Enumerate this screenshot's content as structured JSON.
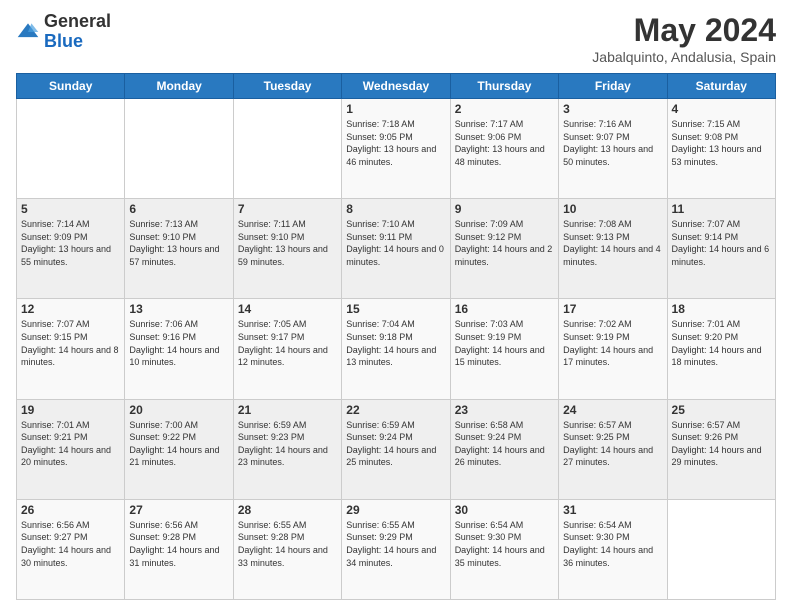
{
  "header": {
    "logo_general": "General",
    "logo_blue": "Blue",
    "month_title": "May 2024",
    "location": "Jabalquinto, Andalusia, Spain"
  },
  "days_of_week": [
    "Sunday",
    "Monday",
    "Tuesday",
    "Wednesday",
    "Thursday",
    "Friday",
    "Saturday"
  ],
  "weeks": [
    [
      {
        "day": "",
        "info": ""
      },
      {
        "day": "",
        "info": ""
      },
      {
        "day": "",
        "info": ""
      },
      {
        "day": "1",
        "info": "Sunrise: 7:18 AM\nSunset: 9:05 PM\nDaylight: 13 hours and 46 minutes."
      },
      {
        "day": "2",
        "info": "Sunrise: 7:17 AM\nSunset: 9:06 PM\nDaylight: 13 hours and 48 minutes."
      },
      {
        "day": "3",
        "info": "Sunrise: 7:16 AM\nSunset: 9:07 PM\nDaylight: 13 hours and 50 minutes."
      },
      {
        "day": "4",
        "info": "Sunrise: 7:15 AM\nSunset: 9:08 PM\nDaylight: 13 hours and 53 minutes."
      }
    ],
    [
      {
        "day": "5",
        "info": "Sunrise: 7:14 AM\nSunset: 9:09 PM\nDaylight: 13 hours and 55 minutes."
      },
      {
        "day": "6",
        "info": "Sunrise: 7:13 AM\nSunset: 9:10 PM\nDaylight: 13 hours and 57 minutes."
      },
      {
        "day": "7",
        "info": "Sunrise: 7:11 AM\nSunset: 9:10 PM\nDaylight: 13 hours and 59 minutes."
      },
      {
        "day": "8",
        "info": "Sunrise: 7:10 AM\nSunset: 9:11 PM\nDaylight: 14 hours and 0 minutes."
      },
      {
        "day": "9",
        "info": "Sunrise: 7:09 AM\nSunset: 9:12 PM\nDaylight: 14 hours and 2 minutes."
      },
      {
        "day": "10",
        "info": "Sunrise: 7:08 AM\nSunset: 9:13 PM\nDaylight: 14 hours and 4 minutes."
      },
      {
        "day": "11",
        "info": "Sunrise: 7:07 AM\nSunset: 9:14 PM\nDaylight: 14 hours and 6 minutes."
      }
    ],
    [
      {
        "day": "12",
        "info": "Sunrise: 7:07 AM\nSunset: 9:15 PM\nDaylight: 14 hours and 8 minutes."
      },
      {
        "day": "13",
        "info": "Sunrise: 7:06 AM\nSunset: 9:16 PM\nDaylight: 14 hours and 10 minutes."
      },
      {
        "day": "14",
        "info": "Sunrise: 7:05 AM\nSunset: 9:17 PM\nDaylight: 14 hours and 12 minutes."
      },
      {
        "day": "15",
        "info": "Sunrise: 7:04 AM\nSunset: 9:18 PM\nDaylight: 14 hours and 13 minutes."
      },
      {
        "day": "16",
        "info": "Sunrise: 7:03 AM\nSunset: 9:19 PM\nDaylight: 14 hours and 15 minutes."
      },
      {
        "day": "17",
        "info": "Sunrise: 7:02 AM\nSunset: 9:19 PM\nDaylight: 14 hours and 17 minutes."
      },
      {
        "day": "18",
        "info": "Sunrise: 7:01 AM\nSunset: 9:20 PM\nDaylight: 14 hours and 18 minutes."
      }
    ],
    [
      {
        "day": "19",
        "info": "Sunrise: 7:01 AM\nSunset: 9:21 PM\nDaylight: 14 hours and 20 minutes."
      },
      {
        "day": "20",
        "info": "Sunrise: 7:00 AM\nSunset: 9:22 PM\nDaylight: 14 hours and 21 minutes."
      },
      {
        "day": "21",
        "info": "Sunrise: 6:59 AM\nSunset: 9:23 PM\nDaylight: 14 hours and 23 minutes."
      },
      {
        "day": "22",
        "info": "Sunrise: 6:59 AM\nSunset: 9:24 PM\nDaylight: 14 hours and 25 minutes."
      },
      {
        "day": "23",
        "info": "Sunrise: 6:58 AM\nSunset: 9:24 PM\nDaylight: 14 hours and 26 minutes."
      },
      {
        "day": "24",
        "info": "Sunrise: 6:57 AM\nSunset: 9:25 PM\nDaylight: 14 hours and 27 minutes."
      },
      {
        "day": "25",
        "info": "Sunrise: 6:57 AM\nSunset: 9:26 PM\nDaylight: 14 hours and 29 minutes."
      }
    ],
    [
      {
        "day": "26",
        "info": "Sunrise: 6:56 AM\nSunset: 9:27 PM\nDaylight: 14 hours and 30 minutes."
      },
      {
        "day": "27",
        "info": "Sunrise: 6:56 AM\nSunset: 9:28 PM\nDaylight: 14 hours and 31 minutes."
      },
      {
        "day": "28",
        "info": "Sunrise: 6:55 AM\nSunset: 9:28 PM\nDaylight: 14 hours and 33 minutes."
      },
      {
        "day": "29",
        "info": "Sunrise: 6:55 AM\nSunset: 9:29 PM\nDaylight: 14 hours and 34 minutes."
      },
      {
        "day": "30",
        "info": "Sunrise: 6:54 AM\nSunset: 9:30 PM\nDaylight: 14 hours and 35 minutes."
      },
      {
        "day": "31",
        "info": "Sunrise: 6:54 AM\nSunset: 9:30 PM\nDaylight: 14 hours and 36 minutes."
      },
      {
        "day": "",
        "info": ""
      }
    ]
  ]
}
